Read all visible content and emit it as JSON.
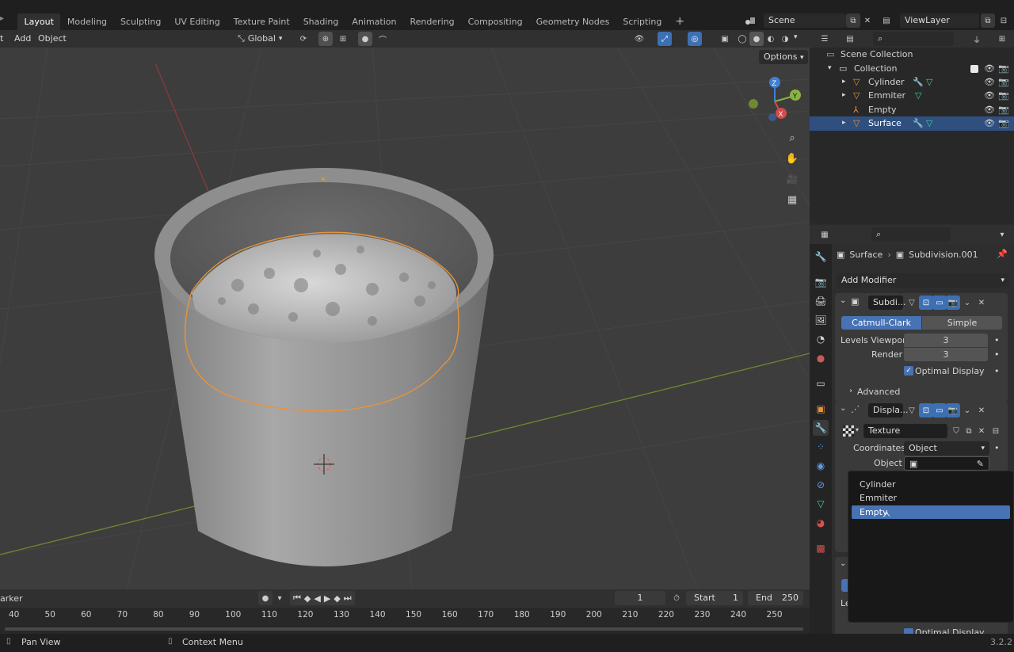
{
  "workspace_tabs": [
    "Layout",
    "Modeling",
    "Sculpting",
    "UV Editing",
    "Texture Paint",
    "Shading",
    "Animation",
    "Rendering",
    "Compositing",
    "Geometry Nodes",
    "Scripting",
    "+"
  ],
  "scene": {
    "name": "Scene",
    "view_layer": "ViewLayer"
  },
  "viewport_header": {
    "menus": [
      "t",
      "Add",
      "Object"
    ],
    "transform_orientation": "Global",
    "options_label": "Options"
  },
  "outliner": {
    "search_placeholder": "",
    "rows": [
      {
        "label": "Scene Collection",
        "kind": "scene"
      },
      {
        "label": "Collection",
        "kind": "collection"
      },
      {
        "label": "Cylinder",
        "kind": "mesh"
      },
      {
        "label": "Emmiter",
        "kind": "mesh"
      },
      {
        "label": "Empty",
        "kind": "empty"
      },
      {
        "label": "Surface",
        "kind": "mesh",
        "selected": true
      }
    ]
  },
  "properties": {
    "breadcrumb_object": "Surface",
    "breadcrumb_modifier": "Subdivision.001",
    "add_modifier_label": "Add Modifier",
    "subdiv": {
      "name": "Subdi...",
      "mode_left": "Catmull-Clark",
      "mode_right": "Simple",
      "levels_viewport_label": "Levels Viewpor",
      "levels_viewport_value": "3",
      "render_label": "Render",
      "render_value": "3",
      "optimal_display_label": "Optimal Display",
      "advanced_label": "Advanced"
    },
    "displace": {
      "name": "Displa...",
      "texture_label": "Texture",
      "coordinates_label": "Coordinates",
      "coordinates_value": "Object",
      "object_label": "Object",
      "object_value": ""
    },
    "bottom_partial_label": "Le",
    "bottom_optimal_display": "Optimal Display"
  },
  "dropdown": {
    "items": [
      "Cylinder",
      "Emmiter",
      "Empty"
    ],
    "highlighted": "Empty"
  },
  "timeline": {
    "marker_label": "arker",
    "current_frame": "1",
    "start_label": "Start",
    "start_value": "1",
    "end_label": "End",
    "end_value": "250",
    "ticks": [
      "40",
      "50",
      "60",
      "70",
      "80",
      "90",
      "100",
      "110",
      "120",
      "130",
      "140",
      "150",
      "160",
      "170",
      "180",
      "190",
      "200",
      "210",
      "220",
      "230",
      "240",
      "250"
    ]
  },
  "statusbar": {
    "pan_view": "Pan View",
    "context_menu": "Context Menu",
    "version": "3.2.2"
  },
  "colors": {
    "accent_blue": "#4772b3",
    "selection_orange": "#e8933a",
    "x_axis": "#d24a4a",
    "y_axis": "#8ab440",
    "z_axis": "#3f7fd8"
  }
}
